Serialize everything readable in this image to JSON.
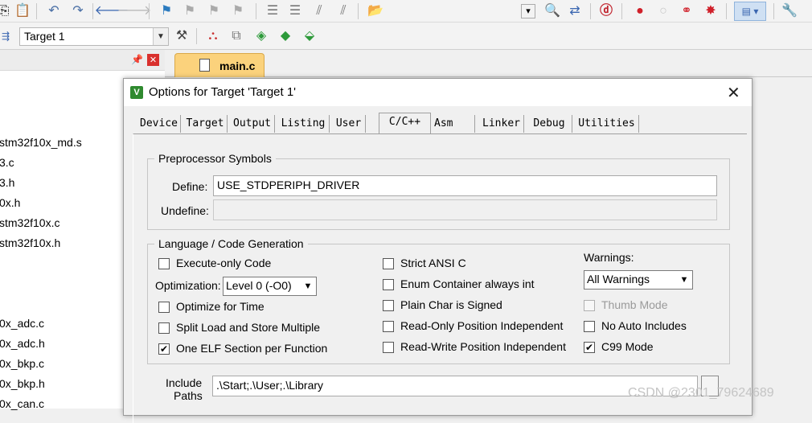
{
  "toolbar": {
    "target_value": "Target 1"
  },
  "project_panel": {
    "files": [
      "stm32f10x_md.s",
      "3.c",
      "3.h",
      "0x.h",
      "stm32f10x.c",
      "stm32f10x.h",
      "0x_adc.c",
      "0x_adc.h",
      "0x_bkp.c",
      "0x_bkp.h",
      "0x_can.c"
    ]
  },
  "editor": {
    "active_tab": "main.c"
  },
  "dialog": {
    "title": "Options for Target 'Target 1'",
    "tabs": [
      "Device",
      "Target",
      "Output",
      "Listing",
      "User",
      "C/C++",
      "Asm",
      "Linker",
      "Debug",
      "Utilities"
    ],
    "active_tab": "C/C++",
    "preprocessor": {
      "group_title": "Preprocessor Symbols",
      "define_label": "Define:",
      "define_value": "USE_STDPERIPH_DRIVER",
      "undefine_label": "Undefine:",
      "undefine_value": ""
    },
    "language": {
      "group_title": "Language / Code Generation",
      "execute_only": {
        "label": "Execute-only Code",
        "checked": false
      },
      "optimization_label": "Optimization:",
      "optimization_value": "Level 0 (-O0)",
      "optimize_time": {
        "label": "Optimize for Time",
        "checked": false
      },
      "split_load": {
        "label": "Split Load and Store Multiple",
        "checked": false
      },
      "one_elf": {
        "label": "One ELF Section per Function",
        "checked": true
      },
      "strict_ansi": {
        "label": "Strict ANSI C",
        "checked": false
      },
      "enum_container": {
        "label": "Enum Container always int",
        "checked": false
      },
      "plain_char": {
        "label": "Plain Char is Signed",
        "checked": false
      },
      "ro_pos": {
        "label": "Read-Only Position Independent",
        "checked": false
      },
      "rw_pos": {
        "label": "Read-Write Position Independent",
        "checked": false
      },
      "warnings_label": "Warnings:",
      "warnings_value": "All Warnings",
      "thumb_mode": {
        "label": "Thumb Mode",
        "checked": false,
        "disabled": true
      },
      "no_auto_includes": {
        "label": "No Auto Includes",
        "checked": false
      },
      "c99_mode": {
        "label": "C99 Mode",
        "checked": true
      }
    },
    "include": {
      "label_line1": "Include",
      "label_line2": "Paths",
      "value": ".\\Start;.\\User;.\\Library"
    }
  },
  "watermark": "CSDN @2301_79624689"
}
